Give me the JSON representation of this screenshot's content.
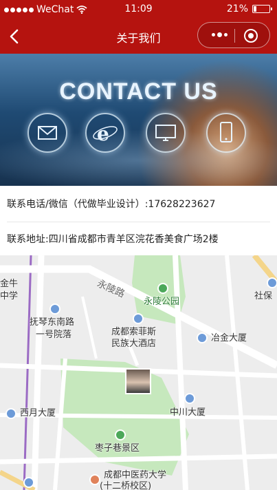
{
  "status_bar": {
    "carrier": "WeChat",
    "time": "11:09",
    "battery": "21%",
    "battery_level": 0.21
  },
  "nav": {
    "title": "关于我们"
  },
  "banner": {
    "headline": "CONTACT US"
  },
  "contact": {
    "phone": "联系电话/微信（代做毕业设计）:17628223627",
    "address": "联系地址:四川省成都市青羊区浣花香美食广场2楼"
  },
  "map": {
    "labels": {
      "jinniu": "金牛",
      "zhongxue": "中学",
      "yongling_road": "永陵路",
      "yongling_park": "永陵公园",
      "shebao": "社保",
      "fuqin_road": "抚琴东南路",
      "yihao_yuan": "一号院落",
      "sofitel_1": "成都索菲斯",
      "sofitel_2": "民族大酒店",
      "yejin": "冶金大厦",
      "xiyue": "西月大厦",
      "zhongchuan": "中川大厦",
      "zaozixiang": "枣子巷景区",
      "tcm_univ": "成都中医药大学",
      "tcm_campus": "(十二桥校区)"
    }
  }
}
